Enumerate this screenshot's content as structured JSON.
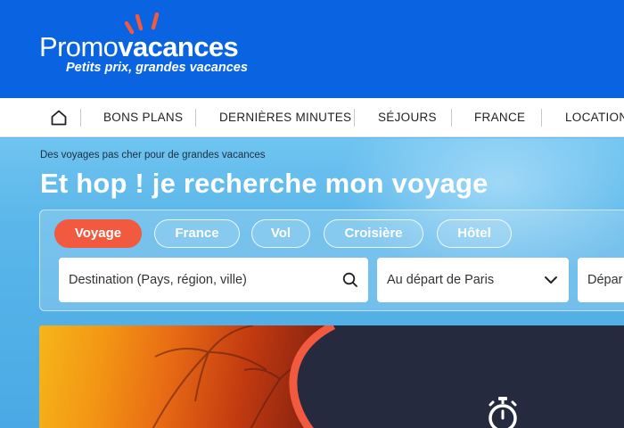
{
  "brand": {
    "name_part1": "Promo",
    "name_part2": "vacances",
    "tagline": "Petits prix, grandes vacances",
    "colors": {
      "header_bg": "#0a63e0",
      "accent": "#f15a3f",
      "ray": "#f15a3f"
    }
  },
  "nav": {
    "home_icon": "home-icon",
    "items": [
      {
        "label": "BONS PLANS"
      },
      {
        "label": "DERNIÈRES MINUTES"
      },
      {
        "label": "SÉJOURS"
      },
      {
        "label": "FRANCE"
      },
      {
        "label": "LOCATION"
      }
    ]
  },
  "hero": {
    "subtitle": "Des voyages pas cher pour de grandes vacances",
    "title": "Et hop ! je recherche mon voyage"
  },
  "search": {
    "tabs": [
      {
        "label": "Voyage",
        "active": true
      },
      {
        "label": "France",
        "active": false
      },
      {
        "label": "Vol",
        "active": false
      },
      {
        "label": "Croisière",
        "active": false
      },
      {
        "label": "Hôtel",
        "active": false
      }
    ],
    "destination": {
      "placeholder": "Destination (Pays, région, ville)",
      "icon": "search-icon"
    },
    "departure": {
      "value": "Au départ de Paris",
      "icon": "chevron-down-icon"
    },
    "date_field": {
      "value": "Dépar"
    }
  },
  "banner": {
    "icon": "stopwatch-icon",
    "colors": {
      "dark": "#262a3e",
      "arc": "#f15a3f"
    }
  }
}
